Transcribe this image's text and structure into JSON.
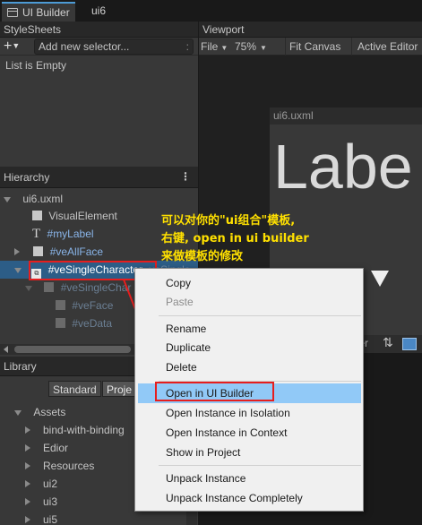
{
  "tabs": [
    {
      "label": "UI Builder",
      "active": true
    },
    {
      "label": "ui6",
      "active": false
    }
  ],
  "stylesheets": {
    "title": "StyleSheets",
    "add_selector_placeholder": "Add new selector...",
    "empty_text": "List is Empty"
  },
  "hierarchy": {
    "title": "Hierarchy",
    "root": "ui6.uxml",
    "items": [
      {
        "label": "VisualElement",
        "depth": 1
      },
      {
        "label": "#myLabel",
        "depth": 1
      },
      {
        "label": "#veAllFace",
        "depth": 1
      },
      {
        "label": "#veSingleCharacter",
        "suffix": "veSingle",
        "depth": 1,
        "selected": true
      },
      {
        "label": "#veSingleChar",
        "depth": 2
      },
      {
        "label": "#veFace",
        "depth": 3
      },
      {
        "label": "#veData",
        "depth": 3
      }
    ]
  },
  "viewport": {
    "title": "Viewport",
    "file_menu": "File",
    "zoom": "75%",
    "fit_canvas": "Fit Canvas",
    "active_editor": "Active Editor",
    "document_name": "ui6.uxml",
    "preview_text": "Labe",
    "bottom_bar_label": "ter"
  },
  "library": {
    "title": "Library",
    "tab_standard": "Standard",
    "tab_project": "Proje",
    "assets_label": "Assets",
    "folders": [
      "bind-with-binding",
      "Edior",
      "Resources",
      "ui2",
      "ui3",
      "ui5"
    ]
  },
  "context_menu": {
    "items": [
      {
        "label": "Copy",
        "disabled": false
      },
      {
        "label": "Paste",
        "disabled": true
      },
      {
        "label": "Rename",
        "disabled": false
      },
      {
        "label": "Duplicate",
        "disabled": false
      },
      {
        "label": "Delete",
        "disabled": false
      },
      {
        "label": "Open in UI Builder",
        "disabled": false,
        "highlighted": true
      },
      {
        "label": "Open Instance in Isolation",
        "disabled": false
      },
      {
        "label": "Open Instance in Context",
        "disabled": false
      },
      {
        "label": "Show in Project",
        "disabled": false
      },
      {
        "label": "Unpack Instance",
        "disabled": false
      },
      {
        "label": "Unpack Instance Completely",
        "disabled": false
      }
    ]
  },
  "annotation": {
    "lines": [
      "可以对你的\"ui组合\"模板,",
      "右键, open in ui builder",
      "来做模板的修改"
    ],
    "color": "#ffe000",
    "box_color": "#e61e1e"
  }
}
